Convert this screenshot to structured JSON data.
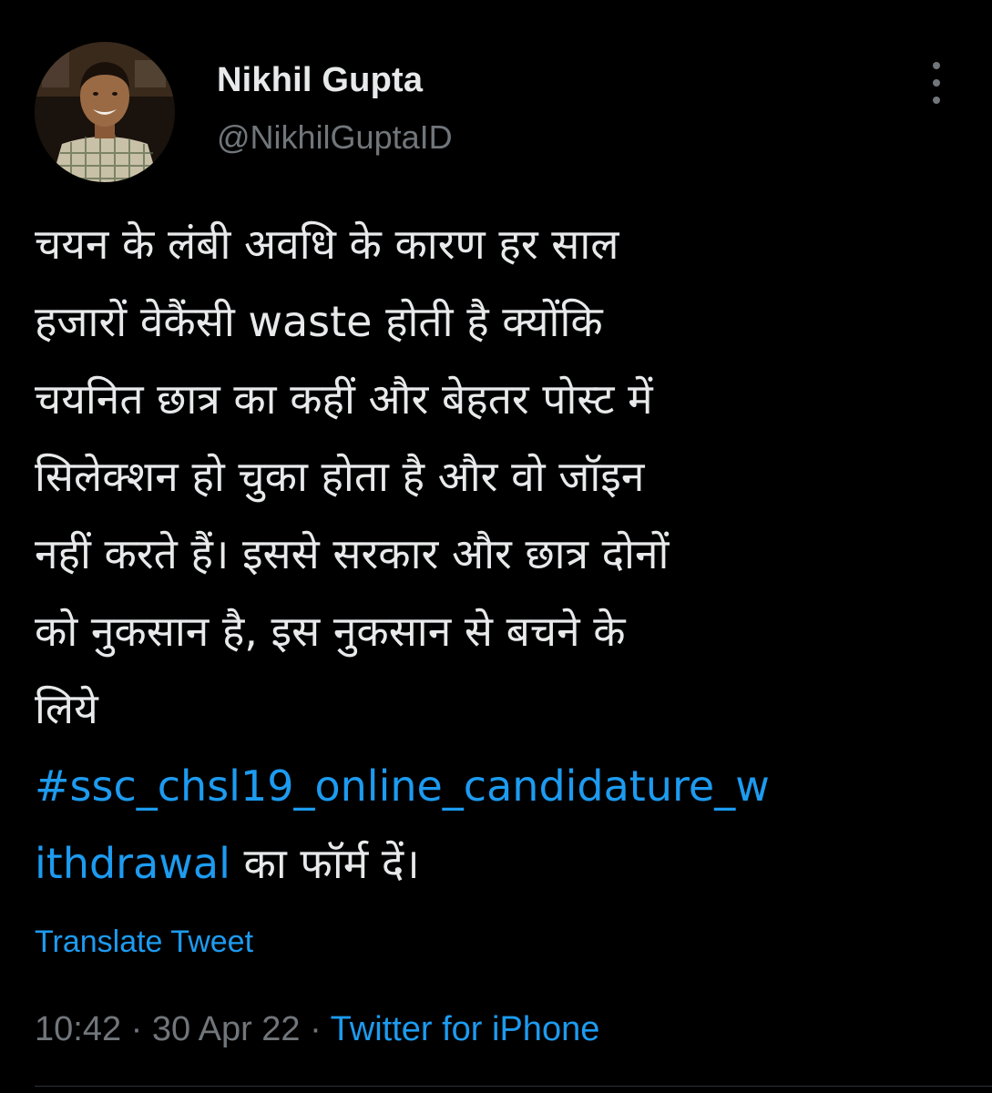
{
  "author": {
    "display_name": "Nikhil Gupta",
    "handle": "@NikhilGuptaID",
    "avatar_icon": "profile-photo"
  },
  "more_icon": "more-options-icon",
  "tweet": {
    "lines": [
      "चयन के लंबी अवधि के कारण हर साल",
      "हजारों वेकैंसी waste होती है क्योंकि",
      "चयनित छात्र का कहीं और बेहतर पोस्ट में",
      "सिलेक्शन हो चुका होता है और वो जॉइन",
      "नहीं करते हैं। इससे सरकार और छात्र दोनों",
      "को नुकसान है, इस नुकसान से बचने के",
      "लिये"
    ],
    "hashtag_line1": "#ssc_chsl19_online_candidature_w",
    "hashtag_line2": "ithdrawal",
    "tail_text": " का फॉर्म दें।"
  },
  "translate_label": "Translate Tweet",
  "meta": {
    "time": "10:42",
    "separator": " · ",
    "date": "30 Apr 22",
    "source": "Twitter for iPhone"
  },
  "colors": {
    "background": "#000000",
    "text": "#e7e9ea",
    "secondary": "#71767b",
    "accent": "#1d9bf0"
  }
}
